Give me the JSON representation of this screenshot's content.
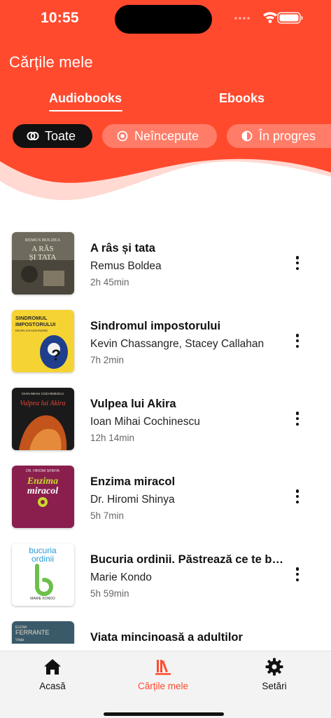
{
  "status_bar": {
    "time": "10:55"
  },
  "header": {
    "title": "Cărțile mele",
    "tabs": [
      {
        "label": "Audiobooks",
        "active": true
      },
      {
        "label": "Ebooks",
        "active": false
      }
    ],
    "filters": [
      {
        "label": "Toate",
        "icon": "infinity-icon",
        "selected": true
      },
      {
        "label": "Neîncepute",
        "icon": "radio-dot-icon",
        "selected": false
      },
      {
        "label": "În progres",
        "icon": "half-circle-icon",
        "selected": false
      }
    ]
  },
  "books": [
    {
      "title": "A râs și tata",
      "author": "Remus Boldea",
      "duration": "2h 45min",
      "cover": {
        "bg": "#6e6a5e",
        "line1": "REMUS BOLDEA",
        "line2": "A RÂS",
        "line3": "ȘI TATA"
      }
    },
    {
      "title": "Sindromul impostorului",
      "author": "Kevin Chassangre, Stacey Callahan",
      "duration": "7h 2min",
      "cover": {
        "bg": "#f5d332",
        "line1": "SINDROMUL",
        "line2": "IMPOSTORULUI",
        "line3": "KEVIN CHASSANGRE"
      }
    },
    {
      "title": "Vulpea lui Akira",
      "author": "Ioan Mihai Cochinescu",
      "duration": "12h 14min",
      "cover": {
        "bg": "#1a1a1a",
        "line1": "IOAN MIHAI COCHINESCU",
        "line2": "Vulpea lui Akira",
        "line3": ""
      }
    },
    {
      "title": "Enzima miracol",
      "author": "Dr. Hiromi Shinya",
      "duration": "5h 7min",
      "cover": {
        "bg": "#8a1f4e",
        "line1": "DR. HIROMI SHINYA",
        "line2": "Enzima",
        "line3": "miracol"
      }
    },
    {
      "title": "Bucuria ordinii. Păstrează ce te bucură",
      "author": "Marie Kondo",
      "duration": "5h 59min",
      "cover": {
        "bg": "#ffffff",
        "line1": "bucuria",
        "line2": "ordinii",
        "line3": "MARIE KONDO"
      }
    },
    {
      "title": "Viata mincinoasă a adultilor",
      "author": "",
      "duration": "",
      "cover": {
        "bg": "#3a5a6a",
        "line1": "ELENA",
        "line2": "FERRANTE",
        "line3": "Viața"
      }
    }
  ],
  "bottom_nav": [
    {
      "label": "Acasă",
      "icon": "home-icon",
      "active": false
    },
    {
      "label": "Cărțile mele",
      "icon": "library-icon",
      "active": true
    },
    {
      "label": "Setări",
      "icon": "gear-icon",
      "active": false
    }
  ],
  "colors": {
    "accent": "#ff4a2e",
    "chip_selected": "#111111"
  }
}
